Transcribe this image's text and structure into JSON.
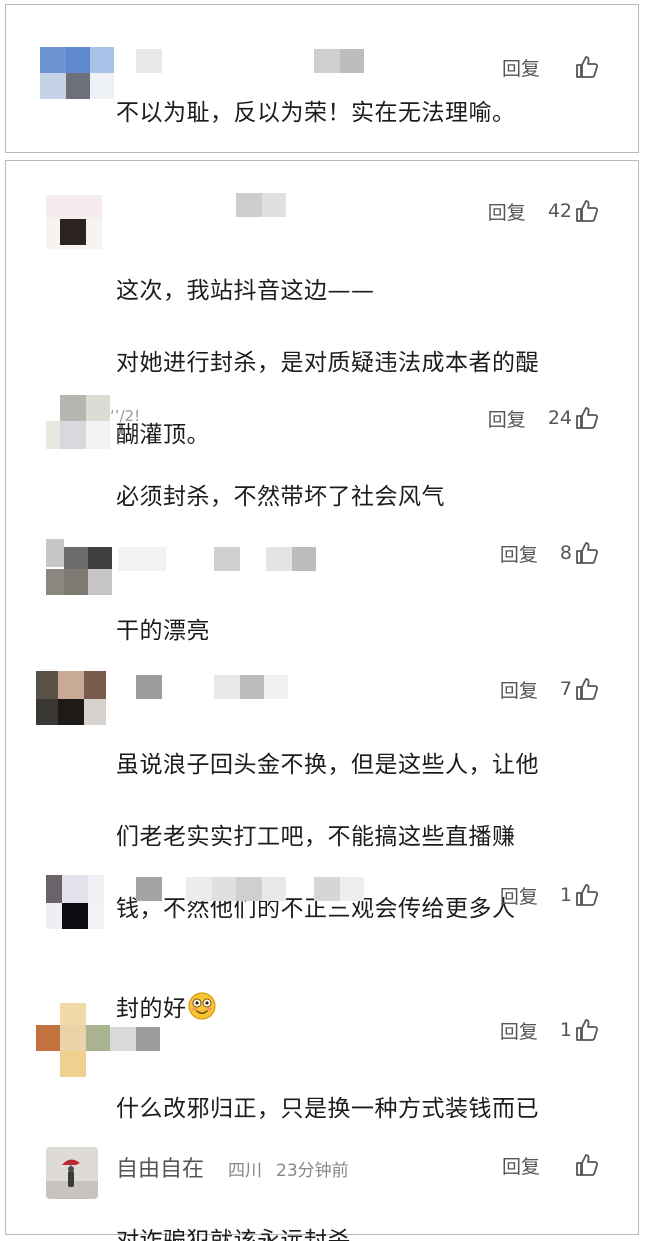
{
  "reply_label": "回复",
  "top_comment": {
    "text": "不以为耻，反以为荣！实在无法理喻。",
    "likes": ""
  },
  "comments": [
    {
      "lines": [
        "这次，我站抖音这边——",
        "对她进行封杀，是对质疑违法成本者的醍",
        "醐灌顶。"
      ],
      "likes": "42"
    },
    {
      "lines": [
        "必须封杀，不然带坏了社会风气"
      ],
      "likes": "24"
    },
    {
      "lines": [
        "干的漂亮"
      ],
      "likes": "8"
    },
    {
      "lines": [
        "虽说浪子回头金不换，但是这些人，让他",
        "们老老实实打工吧，不能搞这些直播赚",
        "钱，不然他们的不正三观会传给更多人"
      ],
      "likes": "7"
    },
    {
      "lines": [
        "封的好"
      ],
      "likes": "1",
      "emoji": "flushed-smile-emoji"
    },
    {
      "lines": [
        "什么改邪归正，只是换一种方式装钱而已"
      ],
      "likes": "1"
    }
  ],
  "last_comment": {
    "username": "自由自在",
    "location": "四川",
    "time": "23分钟前",
    "text": "对诈骗犯就该永远封杀",
    "likes": ""
  },
  "partial_username_fragment": "‘’/2!",
  "colors": {
    "text": "#1c1c1c",
    "secondary": "#555555",
    "border": "#b9b9b9"
  }
}
